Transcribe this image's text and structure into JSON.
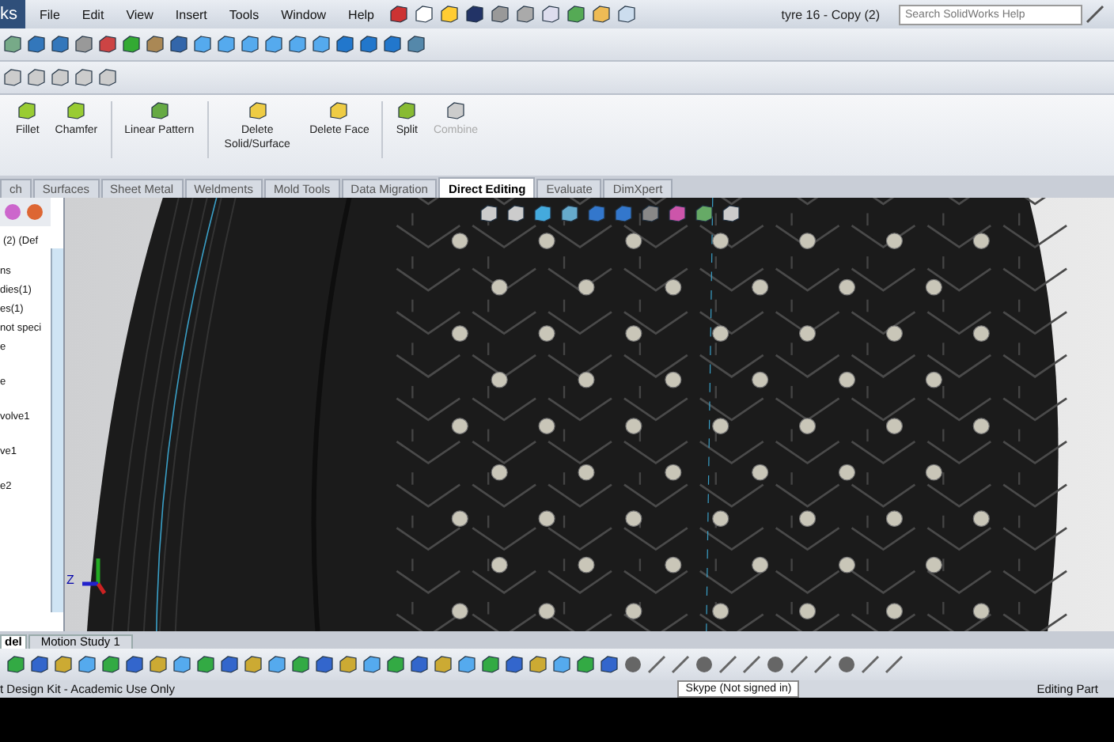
{
  "title_bar": {
    "app_name_fragment": "ks",
    "menu": [
      "File",
      "Edit",
      "View",
      "Insert",
      "Tools",
      "Window",
      "Help"
    ],
    "document_title": "tyre 16 - Copy (2)",
    "search": {
      "placeholder": "Search SolidWorks Help"
    }
  },
  "command_manager": {
    "buttons": [
      {
        "label": "Fillet",
        "disabled": false
      },
      {
        "label": "Chamfer",
        "disabled": false
      },
      {
        "label": "Linear Pattern",
        "disabled": false
      },
      {
        "label": "Delete Solid/Surface",
        "disabled": false
      },
      {
        "label": "Delete Face",
        "disabled": false
      },
      {
        "label": "Split",
        "disabled": false
      },
      {
        "label": "Combine",
        "disabled": true
      }
    ]
  },
  "tabs": [
    {
      "label": "ch",
      "selected": false
    },
    {
      "label": "Surfaces",
      "selected": false
    },
    {
      "label": "Sheet Metal",
      "selected": false
    },
    {
      "label": "Weldments",
      "selected": false
    },
    {
      "label": "Mold Tools",
      "selected": false
    },
    {
      "label": "Data Migration",
      "selected": false
    },
    {
      "label": "Direct Editing",
      "selected": true
    },
    {
      "label": "Evaluate",
      "selected": false
    },
    {
      "label": "DimXpert",
      "selected": false
    }
  ],
  "feature_tree": {
    "header": "(2)  (Def",
    "items": [
      "ns",
      "dies(1)",
      "es(1)",
      "not speci",
      "e",
      "e",
      "volve1",
      "ve1",
      "e2"
    ]
  },
  "viewport": {
    "triad_label": "Z"
  },
  "bottom_tabs": [
    {
      "label": "del",
      "selected": true
    },
    {
      "label": "Motion Study 1",
      "selected": false
    }
  ],
  "status_bar": {
    "left": "t Design Kit - Academic Use Only",
    "tooltip": "Skype (Not signed in)",
    "right": "Editing Part"
  }
}
